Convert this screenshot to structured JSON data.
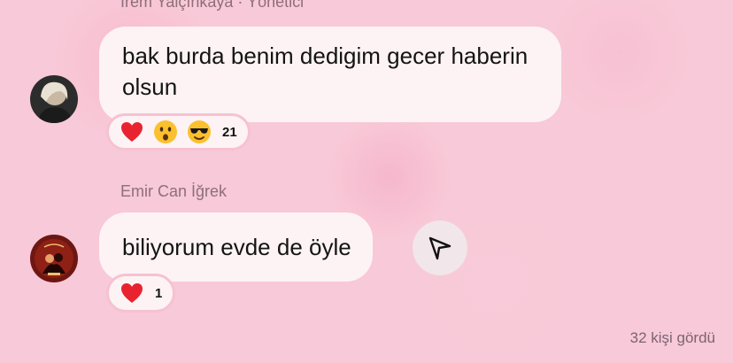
{
  "messages": [
    {
      "sender": "İrem Yalçınkaya · Yönetici",
      "lines": [
        "bak burda benim dedigim gecer haberin",
        "olsun"
      ],
      "reactions": [
        "heart",
        "surprised",
        "cool"
      ],
      "reaction_count": "21"
    },
    {
      "sender": "Emir Can İğrek",
      "lines": [
        "biliyorum evde de öyle"
      ],
      "reactions": [
        "heart"
      ],
      "reaction_count": "1"
    }
  ],
  "seen_text": "32 kişi gördü",
  "colors": {
    "background": "#f8c9d8",
    "bubble": "#fdf3f5",
    "heart": "#e8232f"
  }
}
